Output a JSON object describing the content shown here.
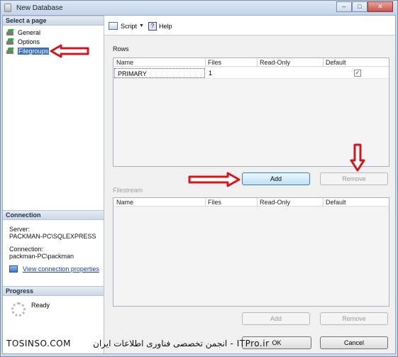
{
  "window": {
    "title": "New Database",
    "controls": {
      "minimize": "–",
      "maximize": "□",
      "close": "✕"
    }
  },
  "left_pane": {
    "select_page_header": "Select a page",
    "pages": [
      {
        "label": "General",
        "icon": "page-icon",
        "selected": false
      },
      {
        "label": "Options",
        "icon": "page-icon",
        "selected": false
      },
      {
        "label": "Filegroups",
        "icon": "page-icon",
        "selected": true
      }
    ],
    "connection": {
      "header": "Connection",
      "server_label": "Server:",
      "server_value": "PACKMAN-PC\\SQLEXPRESS",
      "connection_label": "Connection:",
      "connection_value": "packman-PC\\packman",
      "link": "View connection properties"
    },
    "progress": {
      "header": "Progress",
      "status": "Ready"
    }
  },
  "toolbar": {
    "script_label": "Script",
    "help_label": "Help"
  },
  "rows_section": {
    "label": "Rows",
    "columns": [
      "Name",
      "Files",
      "Read-Only",
      "Default"
    ],
    "rows": [
      {
        "name": "PRIMARY",
        "files": "1",
        "read_only": "",
        "default_checked": true
      }
    ],
    "add_button": "Add",
    "remove_button": "Remove"
  },
  "filestream_section": {
    "label": "Filestream",
    "columns": [
      "Name",
      "Files",
      "Read-Only",
      "Default"
    ],
    "add_button": "Add",
    "remove_button": "Remove"
  },
  "footer": {
    "ok_button": "OK",
    "cancel_button": "Cancel"
  },
  "watermark": {
    "left": "TOSINSO.COM",
    "right": "ITPro.ir - انجمن تخصصی فناوری اطلاعات ایران"
  },
  "colors": {
    "selection": "#3a6fc8",
    "annotation_arrow": "#d4161c",
    "link": "#1a3e9e"
  }
}
